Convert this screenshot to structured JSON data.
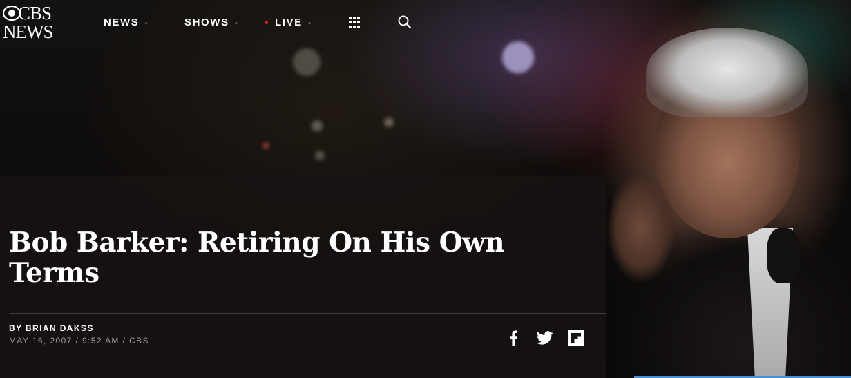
{
  "brand": {
    "logo_line1": "CBS",
    "logo_line2": "NEWS"
  },
  "nav": {
    "items": [
      {
        "label": "NEWS",
        "chevron": "⌄"
      },
      {
        "label": "SHOWS",
        "chevron": "⌄"
      },
      {
        "label": "LIVE",
        "chevron": "⌄",
        "live_dot_color": "#d9251d"
      }
    ],
    "apps_icon": "grid-icon",
    "search_icon": "search-icon"
  },
  "article": {
    "headline": "Bob Barker: Retiring On His Own Terms",
    "byline": "BY BRIAN DAKSS",
    "dateline": "MAY 16, 2007 / 9:52 AM / CBS"
  },
  "share": {
    "facebook_icon": "f",
    "twitter_icon": "twitter-bird",
    "flipboard_icon": "flipboard"
  },
  "colors": {
    "accent_live": "#d9251d",
    "text": "#ffffff",
    "muted": "#9a9a9a"
  }
}
